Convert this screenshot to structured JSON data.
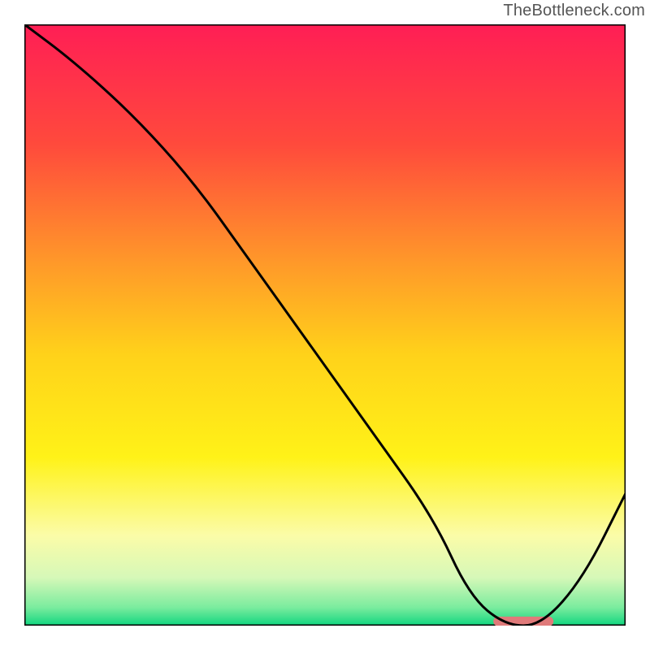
{
  "watermark": "TheBottleneck.com",
  "chart_data": {
    "type": "line",
    "title": "",
    "xlabel": "",
    "ylabel": "",
    "xlim": [
      0,
      100
    ],
    "ylim": [
      0,
      100
    ],
    "grid": false,
    "legend": false,
    "background_gradient": {
      "stops": [
        {
          "offset": 0,
          "color": "#ff1e55"
        },
        {
          "offset": 20,
          "color": "#ff4a3c"
        },
        {
          "offset": 40,
          "color": "#ff9a29"
        },
        {
          "offset": 55,
          "color": "#ffd21a"
        },
        {
          "offset": 72,
          "color": "#fff218"
        },
        {
          "offset": 85,
          "color": "#fbfca8"
        },
        {
          "offset": 92,
          "color": "#d6f8b8"
        },
        {
          "offset": 97,
          "color": "#7aec9e"
        },
        {
          "offset": 100,
          "color": "#10d67f"
        }
      ]
    },
    "series": [
      {
        "name": "bottleneck-curve",
        "color": "#000000",
        "x": [
          0,
          8,
          18,
          28,
          38,
          48,
          58,
          68,
          74,
          80,
          86,
          93,
          100
        ],
        "y": [
          100,
          94,
          85,
          74,
          60,
          46,
          32,
          18,
          5,
          0,
          0,
          8,
          22
        ]
      }
    ],
    "markers": [
      {
        "name": "optimal-segment",
        "shape": "rounded-bar",
        "color": "#e07a7a",
        "x_start": 78,
        "x_end": 88,
        "y": 0.7,
        "height": 1.6
      }
    ]
  }
}
